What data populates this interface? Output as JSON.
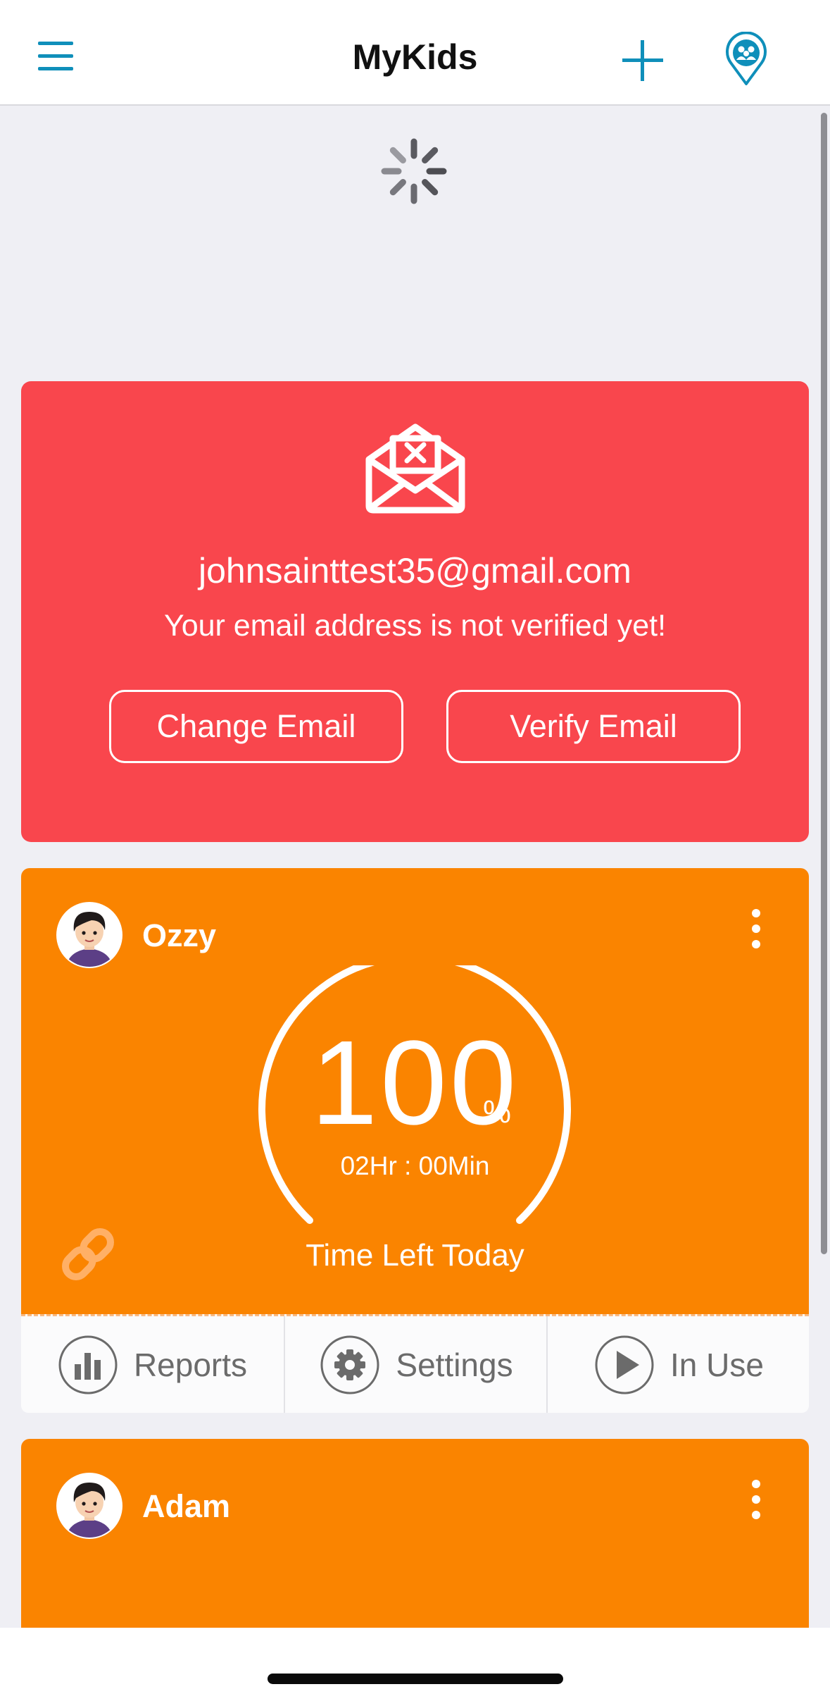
{
  "navbar": {
    "title": "MyKids",
    "menu_icon": "hamburger-icon",
    "add_icon": "plus-icon",
    "family_icon": "family-location-pin-icon",
    "accent_color": "#0f8fba"
  },
  "loading": {
    "icon": "spinner-icon"
  },
  "email_banner": {
    "icon": "envelope-error-icon",
    "email": "johnsainttest35@gmail.com",
    "message": "Your email address is not verified yet!",
    "change_label": "Change Email",
    "verify_label": "Verify Email",
    "background": "#f9464d"
  },
  "kids": [
    {
      "name": "Ozzy",
      "avatar_icon": "boy-avatar-icon",
      "percent_value": "100",
      "percent_sign": "%",
      "time_remaining": "02Hr : 00Min",
      "time_caption": "Time Left Today",
      "link_icon": "link-icon",
      "menu_icon": "more-vertical-icon",
      "background": "#fa8400",
      "actions": {
        "reports_label": "Reports",
        "settings_label": "Settings",
        "in_use_label": "In Use"
      }
    },
    {
      "name": "Adam",
      "avatar_icon": "boy-avatar-icon",
      "menu_icon": "more-vertical-icon",
      "background": "#fa8400"
    }
  ]
}
